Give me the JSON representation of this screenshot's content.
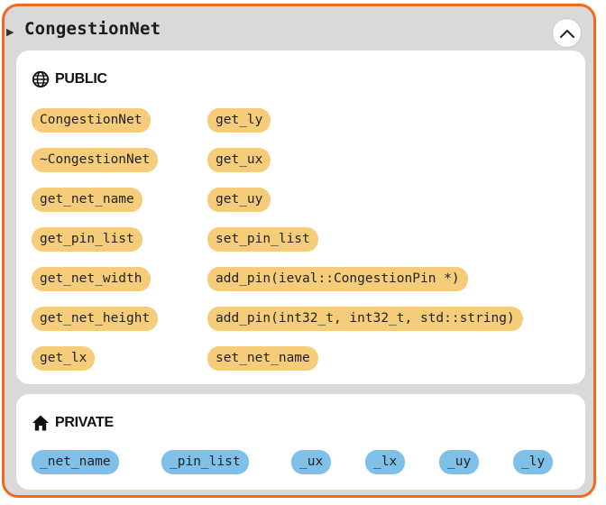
{
  "class_node": {
    "title": "CongestionNet",
    "expanded": true,
    "border_color": "#f06a1e",
    "background_color": "#d9d9d9",
    "public": {
      "label": "PUBLIC",
      "icon": "globe-icon",
      "pill_color": "#f5cd7a",
      "methods_col1": [
        "CongestionNet",
        "~CongestionNet",
        "get_net_name",
        "get_pin_list",
        "get_net_width",
        "get_net_height",
        "get_lx"
      ],
      "methods_col2": [
        "get_ly",
        "get_ux",
        "get_uy",
        "set_pin_list",
        "add_pin(ieval::CongestionPin *)",
        "add_pin(int32_t, int32_t, std::string)",
        "set_net_name"
      ]
    },
    "private": {
      "label": "PRIVATE",
      "icon": "home-icon",
      "pill_color": "#7fc0e8",
      "members": [
        "_net_name",
        "_pin_list",
        "_ux",
        "_lx",
        "_uy",
        "_ly"
      ]
    }
  }
}
